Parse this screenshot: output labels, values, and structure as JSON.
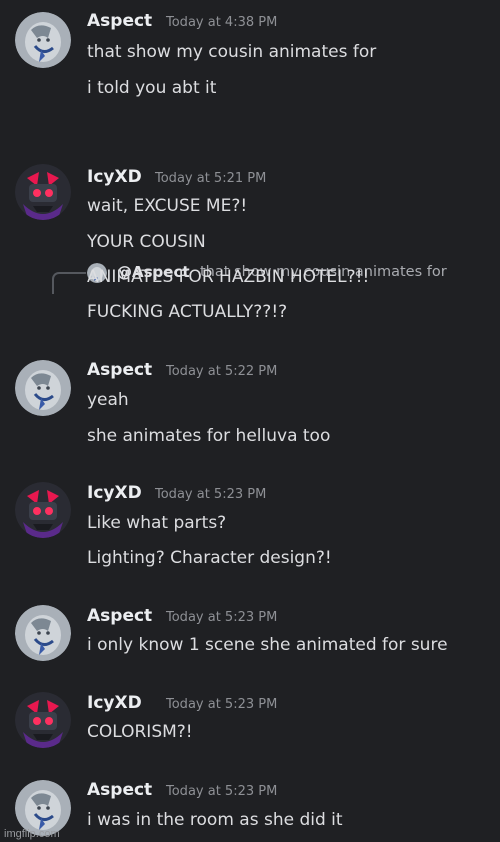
{
  "reply_preview": {
    "author": "@Aspect",
    "text": "that show my cousin animates for"
  },
  "messages": [
    {
      "author": "Aspect",
      "avatar_icon": "aspect-avatar-icon",
      "timestamp": "Today at 4:38 PM",
      "lines": [
        "that show my cousin animates for",
        "i told you abt it"
      ]
    },
    {
      "author": "IcyXD",
      "avatar_icon": "icyxd-avatar-icon",
      "timestamp": "Today at 5:21 PM",
      "lines": [
        "wait, EXCUSE ME?!",
        "YOUR COUSIN",
        "ANIMATES FOR HAZBIN HOTEL?!!",
        "FUCKING ACTUALLY??!?"
      ]
    },
    {
      "author": "Aspect",
      "avatar_icon": "aspect-avatar-icon",
      "timestamp": "Today at 5:22 PM",
      "lines": [
        "yeah",
        "she animates for helluva too"
      ]
    },
    {
      "author": "IcyXD",
      "avatar_icon": "icyxd-avatar-icon",
      "timestamp": "Today at 5:23 PM",
      "lines": [
        "Like what parts?",
        "Lighting? Character design?!"
      ]
    },
    {
      "author": "Aspect",
      "avatar_icon": "aspect-avatar-icon",
      "timestamp": "Today at 5:23 PM",
      "lines": [
        "i only know 1 scene she animated for sure"
      ]
    },
    {
      "author": "IcyXD",
      "avatar_icon": "icyxd-avatar-icon",
      "timestamp": "Today at 5:23 PM",
      "lines": [
        "COLORISM?!"
      ]
    },
    {
      "author": "Aspect",
      "avatar_icon": "aspect-avatar-icon",
      "timestamp": "Today at 5:23 PM",
      "lines": [
        "i was in the room as she did it"
      ]
    }
  ],
  "watermark": "imgflip.com",
  "colors": {
    "background": "#1f2023",
    "username": "#eceef1",
    "timestamp": "#8e9095",
    "message_text": "#dcdde0",
    "icyxd_avatar_accent": "#e8184f"
  }
}
